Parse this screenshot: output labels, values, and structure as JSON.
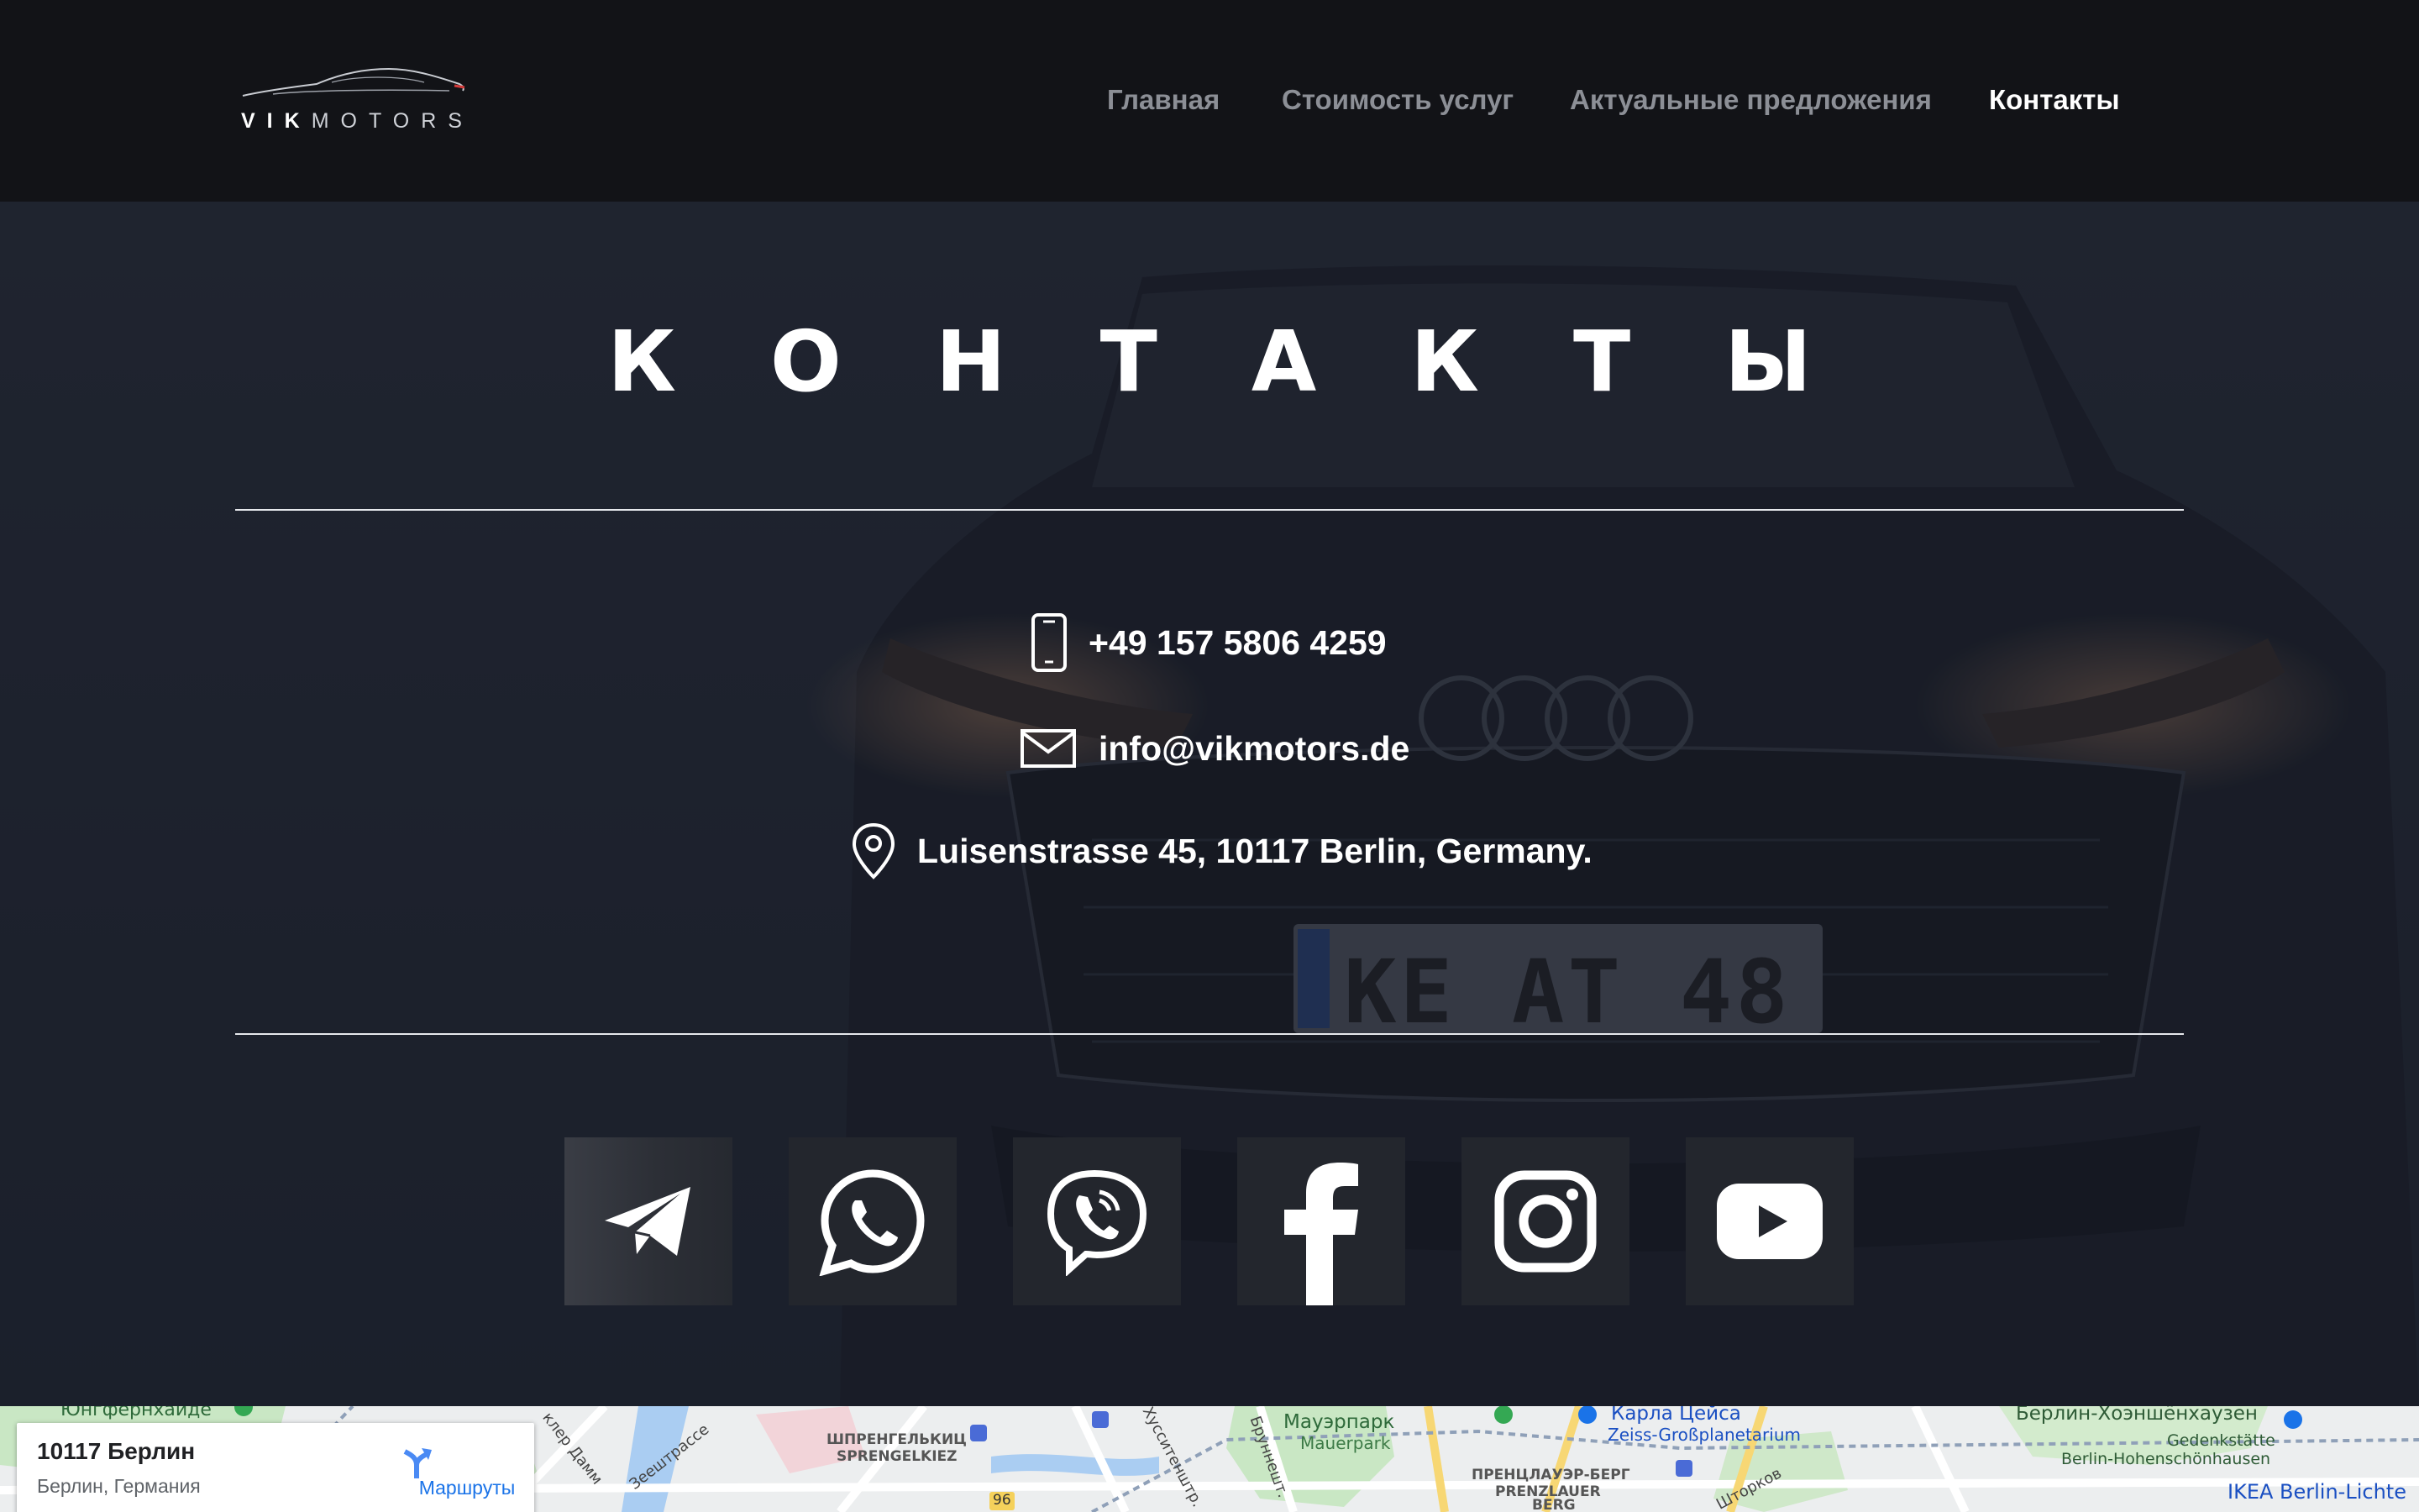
{
  "brand": {
    "logo_bold": "VIK",
    "logo_light": "MOTORS"
  },
  "nav": {
    "items": [
      {
        "label": "Главная"
      },
      {
        "label": "Стоимость услуг"
      },
      {
        "label": "Актуальные предложения"
      },
      {
        "label": "Контакты",
        "active": true
      }
    ]
  },
  "hero": {
    "title": "КОНТАКТЫ",
    "phone": "+49 157 5806 4259",
    "email": "info@vikmotors.de",
    "address": "Luisenstrasse 45, 10117 Berlin, Germany.",
    "plate": "KE AT 48"
  },
  "social": [
    {
      "name": "telegram-icon"
    },
    {
      "name": "whatsapp-icon"
    },
    {
      "name": "viber-icon"
    },
    {
      "name": "facebook-icon"
    },
    {
      "name": "instagram-icon"
    },
    {
      "name": "youtube-icon"
    }
  ],
  "map": {
    "card_title": "10117 Берлин",
    "card_subtitle": "Берлин, Германия",
    "directions_label": "Маршруты",
    "labels": {
      "l1": "Юнгфернхайде",
      "l2": "Мауэрпарк",
      "l3": "Mauerpark",
      "l4": "Карла Цейса",
      "l5": "Zeiss-Großplanetarium",
      "l6": "Берлин-Хоэншёнхаузен",
      "l7": "Gedenkstätte",
      "l8": "Berlin-Hohenschönhausen",
      "l9": "ШПРЕНГЕЛЬКИЦ",
      "l10": "SPRENGELKIEZ",
      "l11": "ПРЕНЦЛАУЭР-БЕРГ",
      "l12": "PRENZLAUER",
      "l13": "BERG",
      "l14": "IKEA Berlin-Lichte",
      "l15": "Зеештрассе",
      "l16": "клер Дамм",
      "l17": "Хусситенштр.",
      "l18": "Бруннешт.",
      "l19": "Шторков",
      "l20": "96"
    }
  },
  "colors": {
    "header_bg": "#121317",
    "nav_inactive": "#8c8f96",
    "nav_active": "#ffffff",
    "map_link": "#1a73e8"
  }
}
